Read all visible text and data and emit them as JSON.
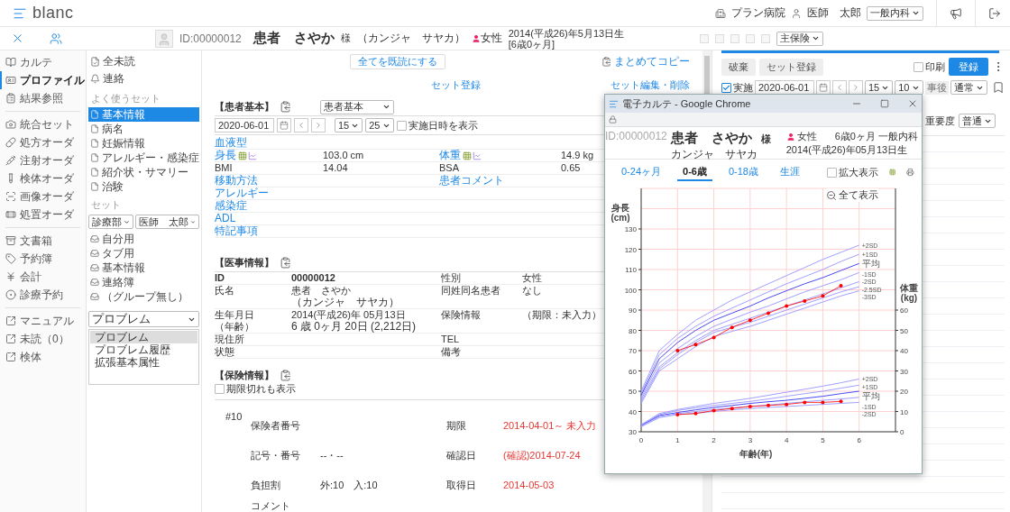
{
  "header": {
    "logo": "blanc",
    "hospital": "プラン病院",
    "user": "医師　太郎",
    "department": "一般内科"
  },
  "patient_bar": {
    "id": "ID:00000012",
    "name": "患者　さやか",
    "honorific": "様",
    "kana": "（カンジャ　サヤカ）",
    "sex": "女性",
    "birth": "2014(平成26)年5月13日生",
    "age": "[6歳0ヶ月]",
    "insurance": "主保険"
  },
  "nav": {
    "groups": [
      {
        "items": [
          {
            "label": "カルテ",
            "selected": false
          },
          {
            "label": "プロファイル",
            "selected": true
          },
          {
            "label": "結果参照",
            "selected": false
          }
        ]
      },
      {
        "items": [
          {
            "label": "統合セット",
            "selected": false
          },
          {
            "label": "処方オーダ",
            "selected": false
          },
          {
            "label": "注射オーダ",
            "selected": false
          },
          {
            "label": "検体オーダ",
            "selected": false
          },
          {
            "label": "画像オーダ",
            "selected": false
          },
          {
            "label": "処置オーダ",
            "selected": false
          }
        ]
      },
      {
        "items": [
          {
            "label": "文書箱",
            "selected": false
          },
          {
            "label": "予約簿",
            "selected": false
          },
          {
            "label": "会計",
            "selected": false
          },
          {
            "label": "診療予約",
            "selected": false
          }
        ]
      },
      {
        "items": [
          {
            "label": "マニュアル",
            "selected": false
          },
          {
            "label": "未読（0）",
            "selected": false
          },
          {
            "label": "検体",
            "selected": false
          }
        ]
      }
    ]
  },
  "set_panel": {
    "links": [
      "全未読",
      "連絡"
    ],
    "favorites_title": "よく使うセット",
    "favorites": [
      {
        "label": "基本情報",
        "selected": true
      },
      {
        "label": "病名",
        "selected": false
      },
      {
        "label": "妊娠情報",
        "selected": false
      },
      {
        "label": "アレルギー・感染症",
        "selected": false
      },
      {
        "label": "紹介状・サマリー",
        "selected": false
      },
      {
        "label": "治験",
        "selected": false
      }
    ],
    "sets_title": "セット",
    "department": "診療部",
    "doctor": "医師　太郎",
    "folders": [
      "自分用",
      "タブ用",
      "基本情報",
      "連絡簿",
      "（グループ無し）"
    ],
    "category": "プロブレム",
    "list": [
      {
        "label": "プロブレム",
        "selected": true
      },
      {
        "label": "プロブレム履歴",
        "selected": false
      },
      {
        "label": "拡張基本属性",
        "selected": false
      }
    ]
  },
  "content": {
    "read_all": "全てを既読にする",
    "copy_all": "まとめてコピー",
    "set_register": "セット登録",
    "set_edit": "セット編集・削除",
    "basic": {
      "title": "【患者基本】",
      "template": "患者基本",
      "date": "2020-06-01",
      "hour": "15",
      "minute": "25",
      "show_time": {
        "label": "実施日時を表示",
        "checked": false
      },
      "rows": [
        {
          "label": "血液型",
          "link": true
        },
        {
          "label": "身長",
          "link": true,
          "graph_icons": true,
          "value": "103.0 cm",
          "label2": "体重",
          "link2": true,
          "graph_icons2": true,
          "value2": "14.9 kg"
        },
        {
          "label": "BMI",
          "link": false,
          "value": "14.04",
          "label2": "BSA",
          "link2": false,
          "value2": "0.65"
        },
        {
          "label": "移動方法",
          "link": true,
          "label2": "患者コメント",
          "link2": true
        },
        {
          "label": "アレルギー",
          "link": true
        },
        {
          "label": "感染症",
          "link": true
        },
        {
          "label": "ADL",
          "link": true
        },
        {
          "label": "特記事項",
          "link": true
        }
      ]
    },
    "medical": {
      "title": "【医事情報】",
      "rows": [
        {
          "label": "ID",
          "value": "00000012",
          "strong": true,
          "label2": "性別",
          "value2": "女性"
        },
        {
          "label": "氏名",
          "value": "患者　さやか",
          "value_sub": "（カンジャ　サヤカ）",
          "strong": false,
          "label2": "同姓同名患者",
          "value2": "なし"
        },
        {
          "label": "生年月日",
          "label_sub": "（年齢）",
          "value": "2014(平成26)年 05月13日",
          "value_sub": "6 歳 0ヶ月 20日 (2,212日)",
          "strong": false,
          "label2": "保険情報",
          "value2": "（期限：未入力）"
        },
        {
          "label": "現住所",
          "strong": false,
          "label2": "TEL"
        },
        {
          "label": "状態",
          "strong": false,
          "label2": "備考"
        }
      ]
    },
    "insurance": {
      "title": "【保険情報】",
      "show_expired": {
        "label": "期限切れも表示",
        "checked": false
      },
      "number": "#10",
      "rows": [
        {
          "label": "保険者番号",
          "label2": "期限",
          "value2": "2014-04-01～ 未入力"
        },
        {
          "label": "記号・番号",
          "value": "--・--",
          "label2": "確認日",
          "value2": "(確認)2014-07-24"
        },
        {
          "label": "負担割",
          "value": "外:10　入:10",
          "label2": "取得日",
          "value2": "2014-05-03"
        }
      ],
      "comment": "コメント"
    }
  },
  "right_panel": {
    "discard": "破棄",
    "set_register": "セット登録",
    "print": {
      "label": "印刷",
      "checked": false
    },
    "register": "登録",
    "done": {
      "label": "実施",
      "checked": true
    },
    "date": "2020-06-01",
    "hour": "15",
    "minute": "10",
    "timing": "事後",
    "type": "通常",
    "importance_label": "重要度",
    "importance": "普通"
  },
  "popup": {
    "title": "電子カルテ - Google Chrome",
    "id": "ID:00000012",
    "name": "患者　さやか",
    "honorific": "様",
    "kana": "カンジャ　サヤカ",
    "sex": "女性",
    "age_dept": "6歳0ヶ月 一般内科",
    "birth": "2014(平成26)年05月13日生",
    "tabs": [
      {
        "label": "0-24ヶ月",
        "selected": false
      },
      {
        "label": "0-6歳",
        "selected": true
      },
      {
        "label": "0-18歳",
        "selected": false
      },
      {
        "label": "生涯",
        "selected": false
      }
    ],
    "zoom": {
      "label": "拡大表示",
      "checked": false
    },
    "reset": "全て表示",
    "chart_data": {
      "type": "line",
      "grid": true,
      "xlabel": "年齢(年)",
      "ylabel": "身長(cm)",
      "y2label": "体重(kg)",
      "x": [
        0,
        0.5,
        1,
        1.5,
        2,
        2.5,
        3,
        3.5,
        4,
        4.5,
        5,
        5.5,
        6
      ],
      "xlim": [
        0,
        7
      ],
      "ylim": [
        30,
        150
      ],
      "y2lim": [
        0,
        120
      ],
      "xticks": [
        0,
        1,
        2,
        3,
        4,
        5,
        6
      ],
      "yticks": [
        30,
        40,
        50,
        60,
        70,
        80,
        90,
        100,
        110,
        120,
        130
      ],
      "y2ticks": [
        0,
        10,
        20,
        30,
        40,
        50,
        60
      ],
      "series": [
        {
          "name": "+2SD",
          "color": "#a0a0ff",
          "values": [
            50,
            70,
            78,
            85,
            90,
            95,
            99,
            103,
            107,
            111,
            115,
            118.5,
            122
          ]
        },
        {
          "name": "+1SD",
          "color": "#a0a0ff",
          "values": [
            49,
            68,
            76,
            82,
            87,
            91,
            95,
            99,
            103,
            106.5,
            110,
            114,
            117.5
          ]
        },
        {
          "name": "平均",
          "color": "#4a4af0",
          "values": [
            48,
            66,
            74,
            80,
            85,
            88.5,
            92,
            96,
            99.5,
            103,
            106,
            109.5,
            113
          ]
        },
        {
          "name": "-1SD",
          "color": "#a0a0ff",
          "values": [
            47,
            64,
            71,
            77,
            82,
            85.5,
            89,
            92,
            95.5,
            99,
            102,
            105,
            108.5
          ]
        },
        {
          "name": "-2SD",
          "color": "#a0a0ff",
          "values": [
            46,
            62,
            69,
            75,
            80,
            83,
            86,
            89,
            92,
            95,
            98,
            101,
            104
          ]
        },
        {
          "name": "-2.5SD",
          "color": "#a0a0ff",
          "values": [
            45,
            61,
            68,
            74,
            79,
            81.5,
            84,
            87,
            90,
            93,
            96,
            99,
            101.5
          ]
        },
        {
          "name": "-3SD",
          "color": "#a0a0ff",
          "values": [
            44,
            60,
            66,
            72,
            77,
            79.5,
            82,
            85,
            88,
            91,
            94,
            97,
            99.5
          ]
        },
        {
          "color": "#ff0000",
          "values": [
            null,
            null,
            70,
            73,
            76.5,
            81.5,
            85,
            88.5,
            92,
            94.5,
            97,
            102,
            null
          ]
        },
        {
          "name": "+2SD",
          "color": "#a0a0ff",
          "axis": "y2",
          "values": [
            3.5,
            9,
            11,
            12.5,
            14,
            15.2,
            16.5,
            18,
            19.5,
            21,
            22.5,
            24.2,
            26
          ]
        },
        {
          "name": "+1SD",
          "color": "#a0a0ff",
          "axis": "y2",
          "values": [
            3.3,
            8.5,
            10.5,
            11.8,
            13,
            14,
            15,
            16.2,
            17.5,
            18.8,
            20,
            21.5,
            23
          ]
        },
        {
          "name": "平均",
          "color": "#4a4af0",
          "axis": "y2",
          "values": [
            3,
            8,
            9.5,
            10.8,
            12,
            13,
            14,
            14.8,
            15.5,
            16.5,
            17.5,
            18.8,
            20
          ]
        },
        {
          "name": "-1SD",
          "color": "#a0a0ff",
          "axis": "y2",
          "values": [
            2.8,
            7.5,
            9,
            10,
            11,
            11.8,
            12.5,
            13.2,
            14,
            14.8,
            15.5,
            16.2,
            17
          ]
        },
        {
          "name": "-2SD",
          "color": "#a0a0ff",
          "axis": "y2",
          "values": [
            2.5,
            7,
            8.5,
            9.2,
            10,
            10.8,
            11.5,
            12,
            12.5,
            13,
            13.5,
            14,
            14.5
          ]
        },
        {
          "color": "#ff0000",
          "axis": "y2",
          "values": [
            null,
            null,
            8.5,
            9,
            10.5,
            11.5,
            12.5,
            13,
            13.5,
            14.5,
            14.5,
            15,
            null
          ]
        }
      ]
    }
  }
}
